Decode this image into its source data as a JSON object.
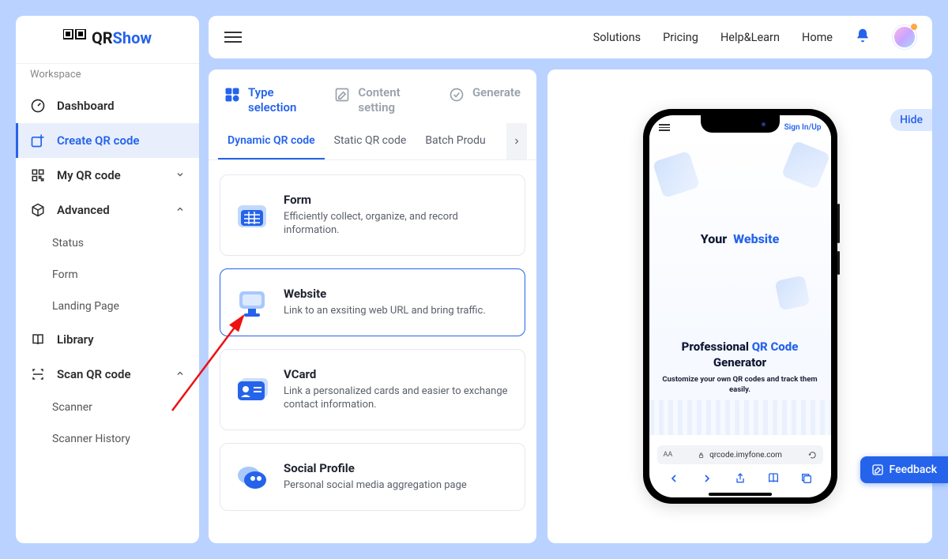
{
  "logo": {
    "prefix": "QR",
    "suffix": "Show"
  },
  "sidebar": {
    "workspace_label": "Workspace",
    "items": {
      "dashboard": "Dashboard",
      "create": "Create QR code",
      "myqr": "My QR code",
      "advanced": "Advanced",
      "library": "Library",
      "scan": "Scan QR code"
    },
    "advanced_items": [
      "Status",
      "Form",
      "Landing Page"
    ],
    "scan_items": [
      "Scanner",
      "Scanner History"
    ]
  },
  "topbar": {
    "links": [
      "Solutions",
      "Pricing",
      "Help&Learn",
      "Home"
    ]
  },
  "steps": {
    "s1": "Type selection",
    "s2": "Content setting",
    "s3": "Generate"
  },
  "tabs": {
    "t1": "Dynamic QR code",
    "t2": "Static QR code",
    "t3": "Batch Produ"
  },
  "types": {
    "form": {
      "title": "Form",
      "desc": "Efficiently collect, organize, and record information."
    },
    "website": {
      "title": "Website",
      "desc": "Link to an exsiting web URL and bring traffic."
    },
    "vcard": {
      "title": "VCard",
      "desc": "Link a personalized cards and easier to exchange contact information."
    },
    "social": {
      "title": "Social Profile",
      "desc": "Personal social media aggregation page"
    }
  },
  "preview": {
    "hide": "Hide",
    "sign": "Sign In/Up",
    "your": "Your",
    "website": "Website",
    "pro1": "Professional ",
    "pro2": "QR Code",
    "pro3": "Generator",
    "sub": "Customize your own QR codes and track them easily.",
    "url": "qrcode.imyfone.com",
    "aa": "AA"
  },
  "feedback": "Feedback"
}
